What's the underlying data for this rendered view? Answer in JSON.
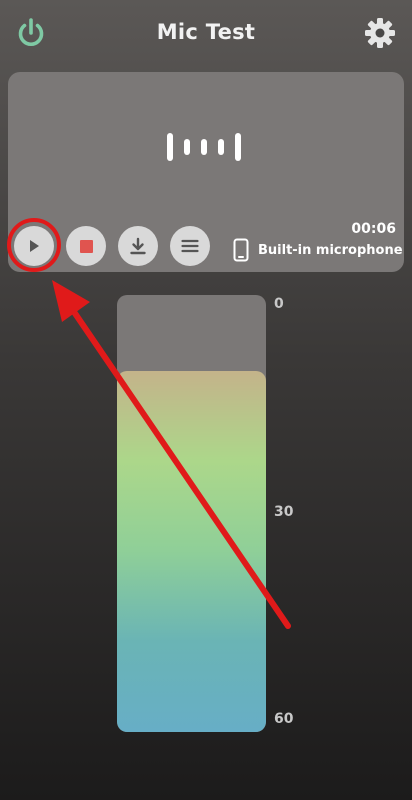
{
  "header": {
    "title": "Mic Test",
    "power_icon": "power-icon",
    "settings_icon": "gear-icon"
  },
  "recorder": {
    "timer": "00:06",
    "device_label": "Built-in microphone",
    "controls": [
      {
        "name": "play",
        "icon": "play-icon"
      },
      {
        "name": "stop",
        "icon": "stop-icon"
      },
      {
        "name": "download",
        "icon": "download-icon"
      },
      {
        "name": "menu",
        "icon": "menu-icon"
      }
    ]
  },
  "meter": {
    "scale": [
      "0",
      "30",
      "60"
    ],
    "level_fraction": 0.825,
    "fill_colors": [
      "#c4b38a",
      "#acd78a",
      "#8fcf98",
      "#6ab4b5",
      "#67aec6"
    ]
  },
  "colors": {
    "accent_power": "#7fc9a4",
    "stop_red": "#e0544f",
    "annotation_red": "#e01a1a",
    "card": "#7b7877"
  }
}
